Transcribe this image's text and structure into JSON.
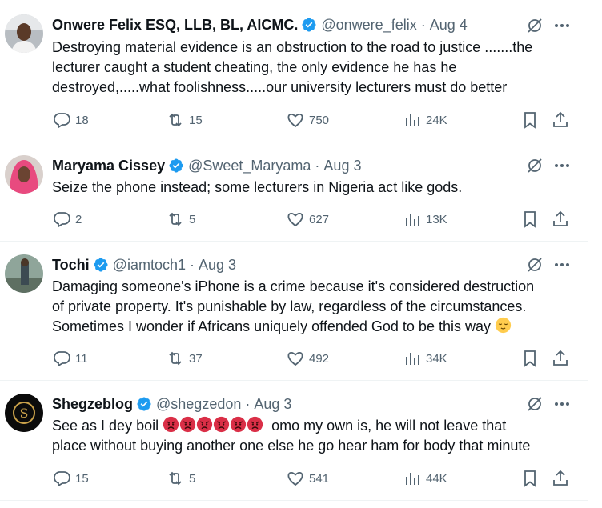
{
  "tweets": [
    {
      "name": "Onwere Felix ESQ, LLB, BL, AICMC.",
      "handle": "@onwere_felix",
      "date": "Aug 4",
      "lines": [
        "Destroying material evidence is an obstruction to the road to justice .......the",
        "lecturer caught a student cheating, the only evidence he has he",
        "destroyed,.....what foolishness.....our university lecturers must do better"
      ],
      "replies": "18",
      "retweets": "15",
      "likes": "750",
      "views": "24K"
    },
    {
      "name": "Maryama Cissey",
      "handle": "@Sweet_Maryama",
      "date": "Aug 3",
      "lines": [
        "Seize the phone instead; some lecturers in Nigeria act like gods."
      ],
      "replies": "2",
      "retweets": "5",
      "likes": "627",
      "views": "13K"
    },
    {
      "name": "Tochi",
      "handle": "@iamtoch1",
      "date": "Aug 3",
      "lines": [
        "Damaging someone's iPhone is a crime because it's considered destruction",
        "of private property. It's punishable by law, regardless of the circumstances.",
        "Sometimes I wonder if Africans uniquely offended God to be this way"
      ],
      "replies": "11",
      "retweets": "37",
      "likes": "492",
      "views": "34K"
    },
    {
      "name": "Shegzeblog",
      "handle": "@shegzedon",
      "date": "Aug 3",
      "lines": [
        "See as I dey boil",
        "omo my own is, he will not leave that",
        "place without  buying another one else he go hear ham for body that minute"
      ],
      "replies": "15",
      "retweets": "5",
      "likes": "541",
      "views": "44K"
    }
  ],
  "separator": "·",
  "colors": {
    "verified": "#1d9bf0",
    "muted": "#536471",
    "text": "#0f1419",
    "border": "#eff3f4"
  },
  "icons": [
    "reply-icon",
    "retweet-icon",
    "like-icon",
    "views-icon",
    "bookmark-icon",
    "share-icon",
    "grok-icon",
    "more-icon",
    "verified-badge-icon"
  ]
}
